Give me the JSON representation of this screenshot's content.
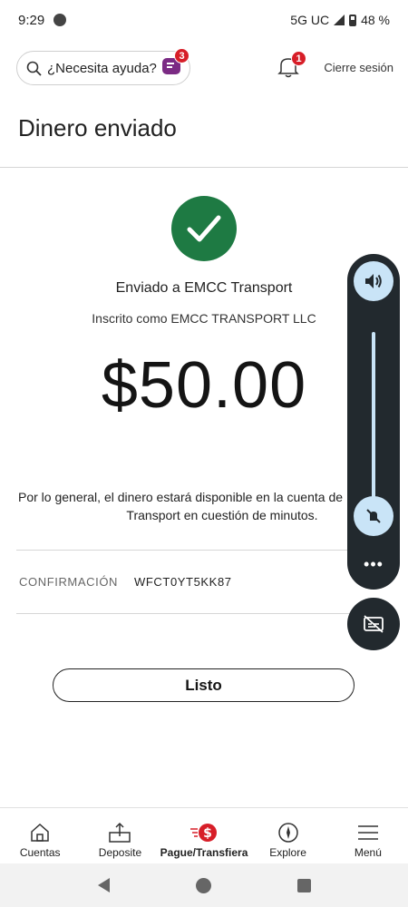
{
  "status_bar": {
    "time": "9:29",
    "network": "5G UC",
    "battery": "48 %"
  },
  "top_bar": {
    "help_placeholder": "¿Necesita ayuda?",
    "chat_badge": "3",
    "notifications_badge": "1",
    "sign_out": "Cierre sesión"
  },
  "page": {
    "title": "Dinero enviado"
  },
  "confirmation": {
    "sent_to": "Enviado a EMCC Transport",
    "enrolled_as": "Inscrito como EMCC TRANSPORT LLC",
    "amount": "$50.00",
    "notice_line1": "Por lo general, el dinero estará disponible en la cuenta de EMCC",
    "notice_line2": "Transport en cuestión de minutos.",
    "conf_label": "CONFIRMACIÓN",
    "conf_value": "WFCT0YT5KK87",
    "done_label": "Listo"
  },
  "volume_overlay": {
    "more": "•••"
  },
  "bottom_nav": {
    "items": [
      {
        "label": "Cuentas",
        "icon": "home-icon"
      },
      {
        "label": "Deposite",
        "icon": "deposit-icon"
      },
      {
        "label": "Pague/Transfiera",
        "icon": "pay-transfer-icon"
      },
      {
        "label": "Explore",
        "icon": "compass-icon"
      },
      {
        "label": "Menú",
        "icon": "menu-icon"
      }
    ]
  },
  "colors": {
    "brand_red": "#d71e28",
    "success_green": "#1e7a43",
    "overlay_dark": "#22292e",
    "overlay_accent": "#c9e4f7"
  }
}
